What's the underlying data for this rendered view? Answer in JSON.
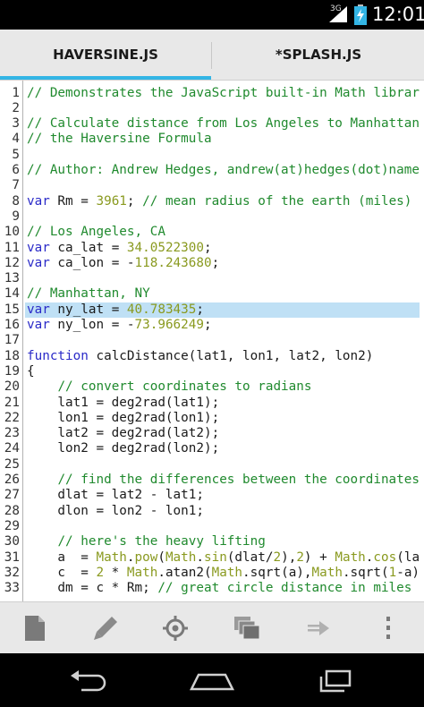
{
  "status_bar": {
    "network": "3G",
    "time": "12:01"
  },
  "tabs": [
    {
      "label": "HAVERSINE.JS",
      "active": true
    },
    {
      "label": "*SPLASH.JS",
      "active": false
    }
  ],
  "editor": {
    "highlighted_line": 15,
    "colors": {
      "comment": "#208a2e",
      "keyword": "#2a2ac8",
      "number": "#8a9a20",
      "highlight": "#bfe0f5",
      "tab_indicator": "#33b5e5"
    },
    "lines": [
      {
        "n": "1",
        "tokens": [
          [
            "comment",
            "// Demonstrates the JavaScript built-in Math librar"
          ]
        ]
      },
      {
        "n": "2",
        "tokens": []
      },
      {
        "n": "3",
        "tokens": [
          [
            "comment",
            "// Calculate distance from Los Angeles to Manhattan"
          ]
        ]
      },
      {
        "n": "4",
        "tokens": [
          [
            "comment",
            "// the Haversine Formula"
          ]
        ]
      },
      {
        "n": "5",
        "tokens": []
      },
      {
        "n": "6",
        "tokens": [
          [
            "comment",
            "// Author: Andrew Hedges, andrew(at)hedges(dot)name"
          ]
        ]
      },
      {
        "n": "7",
        "tokens": []
      },
      {
        "n": "8",
        "tokens": [
          [
            "keyword",
            "var"
          ],
          [
            "plain",
            " Rm = "
          ],
          [
            "number",
            "3961"
          ],
          [
            "plain",
            "; "
          ],
          [
            "comment",
            "// mean radius of the earth (miles)"
          ]
        ]
      },
      {
        "n": "9",
        "tokens": []
      },
      {
        "n": "10",
        "tokens": [
          [
            "comment",
            "// Los Angeles, CA"
          ]
        ]
      },
      {
        "n": "11",
        "tokens": [
          [
            "keyword",
            "var"
          ],
          [
            "plain",
            " ca_lat = "
          ],
          [
            "number",
            "34.0522300"
          ],
          [
            "plain",
            ";"
          ]
        ]
      },
      {
        "n": "12",
        "tokens": [
          [
            "keyword",
            "var"
          ],
          [
            "plain",
            " ca_lon = -"
          ],
          [
            "number",
            "118.243680"
          ],
          [
            "plain",
            ";"
          ]
        ]
      },
      {
        "n": "13",
        "tokens": []
      },
      {
        "n": "14",
        "tokens": [
          [
            "comment",
            "// Manhattan, NY"
          ]
        ]
      },
      {
        "n": "15",
        "tokens": [
          [
            "keyword",
            "var"
          ],
          [
            "plain",
            " ny_lat = "
          ],
          [
            "number",
            "40.783435"
          ],
          [
            "plain",
            ";"
          ]
        ]
      },
      {
        "n": "16",
        "tokens": [
          [
            "keyword",
            "var"
          ],
          [
            "plain",
            " ny_lon = -"
          ],
          [
            "number",
            "73.966249"
          ],
          [
            "plain",
            ";"
          ]
        ]
      },
      {
        "n": "17",
        "tokens": []
      },
      {
        "n": "18",
        "tokens": [
          [
            "keyword",
            "function"
          ],
          [
            "plain",
            " calcDistance(lat1, lon1, lat2, lon2)"
          ]
        ]
      },
      {
        "n": "19",
        "tokens": [
          [
            "plain",
            "{"
          ]
        ]
      },
      {
        "n": "20",
        "tokens": [
          [
            "plain",
            "    "
          ],
          [
            "comment",
            "// convert coordinates to radians"
          ]
        ]
      },
      {
        "n": "21",
        "tokens": [
          [
            "plain",
            "    lat1 = deg2rad(lat1);"
          ]
        ]
      },
      {
        "n": "22",
        "tokens": [
          [
            "plain",
            "    lon1 = deg2rad(lon1);"
          ]
        ]
      },
      {
        "n": "23",
        "tokens": [
          [
            "plain",
            "    lat2 = deg2rad(lat2);"
          ]
        ]
      },
      {
        "n": "24",
        "tokens": [
          [
            "plain",
            "    lon2 = deg2rad(lon2);"
          ]
        ]
      },
      {
        "n": "25",
        "tokens": []
      },
      {
        "n": "26",
        "tokens": [
          [
            "plain",
            "    "
          ],
          [
            "comment",
            "// find the differences between the coordinates"
          ]
        ]
      },
      {
        "n": "27",
        "tokens": [
          [
            "plain",
            "    dlat = lat2 - lat1;"
          ]
        ]
      },
      {
        "n": "28",
        "tokens": [
          [
            "plain",
            "    dlon = lon2 - lon1;"
          ]
        ]
      },
      {
        "n": "29",
        "tokens": []
      },
      {
        "n": "30",
        "tokens": [
          [
            "plain",
            "    "
          ],
          [
            "comment",
            "// here's the heavy lifting"
          ]
        ]
      },
      {
        "n": "31",
        "tokens": [
          [
            "plain",
            "    a  = "
          ],
          [
            "builtin",
            "Math"
          ],
          [
            "plain",
            "."
          ],
          [
            "builtin",
            "pow"
          ],
          [
            "plain",
            "("
          ],
          [
            "builtin",
            "Math"
          ],
          [
            "plain",
            "."
          ],
          [
            "builtin",
            "sin"
          ],
          [
            "plain",
            "(dlat/"
          ],
          [
            "number",
            "2"
          ],
          [
            "plain",
            "),"
          ],
          [
            "number",
            "2"
          ],
          [
            "plain",
            ") + "
          ],
          [
            "builtin",
            "Math"
          ],
          [
            "plain",
            "."
          ],
          [
            "builtin",
            "cos"
          ],
          [
            "plain",
            "(la"
          ]
        ]
      },
      {
        "n": "32",
        "tokens": [
          [
            "plain",
            "    c  = "
          ],
          [
            "number",
            "2"
          ],
          [
            "plain",
            " * "
          ],
          [
            "builtin",
            "Math"
          ],
          [
            "plain",
            ".atan2("
          ],
          [
            "builtin",
            "Math"
          ],
          [
            "plain",
            ".sqrt(a),"
          ],
          [
            "builtin",
            "Math"
          ],
          [
            "plain",
            ".sqrt("
          ],
          [
            "number",
            "1"
          ],
          [
            "plain",
            "-a)"
          ]
        ]
      },
      {
        "n": "33",
        "tokens": [
          [
            "plain",
            "    dm = c * Rm; "
          ],
          [
            "comment",
            "// great circle distance in miles"
          ]
        ]
      }
    ]
  },
  "toolbar": {
    "items": [
      {
        "name": "document-icon"
      },
      {
        "name": "pencil-icon"
      },
      {
        "name": "target-icon"
      },
      {
        "name": "windows-icon"
      },
      {
        "name": "forward-arrow-icon"
      },
      {
        "name": "overflow-menu-icon"
      }
    ]
  },
  "nav_bar": {
    "items": [
      {
        "name": "back-icon"
      },
      {
        "name": "home-icon"
      },
      {
        "name": "recent-apps-icon"
      }
    ]
  }
}
